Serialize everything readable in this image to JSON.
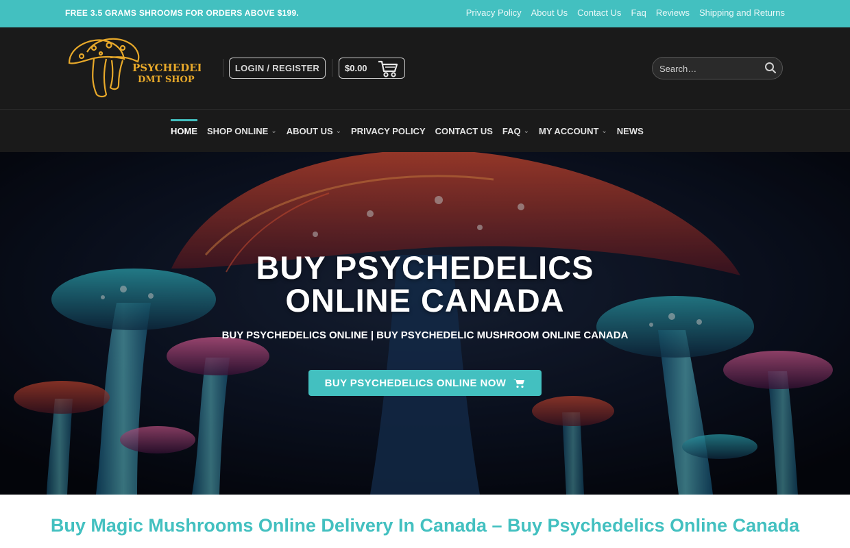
{
  "topbar": {
    "promo": "FREE 3.5 GRAMS SHROOMS FOR ORDERS ABOVE $199.",
    "links": [
      "Privacy Policy",
      "About Us",
      "Contact Us",
      "Faq",
      "Reviews",
      "Shipping and Returns"
    ]
  },
  "header": {
    "logo_line1": "PSYCHEDELIC",
    "logo_line2": "DMT SHOP",
    "login_label": "LOGIN / REGISTER",
    "cart_total": "$0.00",
    "search_placeholder": "Search…"
  },
  "nav": {
    "items": [
      {
        "label": "HOME"
      },
      {
        "label": "SHOP ONLINE"
      },
      {
        "label": "ABOUT US"
      },
      {
        "label": "PRIVACY POLICY"
      },
      {
        "label": "CONTACT US"
      },
      {
        "label": "FAQ"
      },
      {
        "label": "MY ACCOUNT"
      },
      {
        "label": "NEWS"
      }
    ]
  },
  "hero": {
    "title_line1": "BUY PSYCHEDELICS",
    "title_line2": "ONLINE CANADA",
    "subtitle": "BUY PSYCHEDELICS ONLINE | BUY PSYCHEDELIC MUSHROOM ONLINE CANADA",
    "cta_label": "BUY PSYCHEDELICS ONLINE NOW"
  },
  "page": {
    "heading": "Buy Magic Mushrooms Online Delivery In Canada – Buy Psychedelics Online Canada"
  },
  "colors": {
    "accent": "#43c0c0",
    "header_bg": "#1a1a1a",
    "logo_gold": "#e8a92a"
  },
  "icons": [
    "cart-icon",
    "search-icon",
    "chevron-down-icon",
    "shopping-cart-icon"
  ]
}
